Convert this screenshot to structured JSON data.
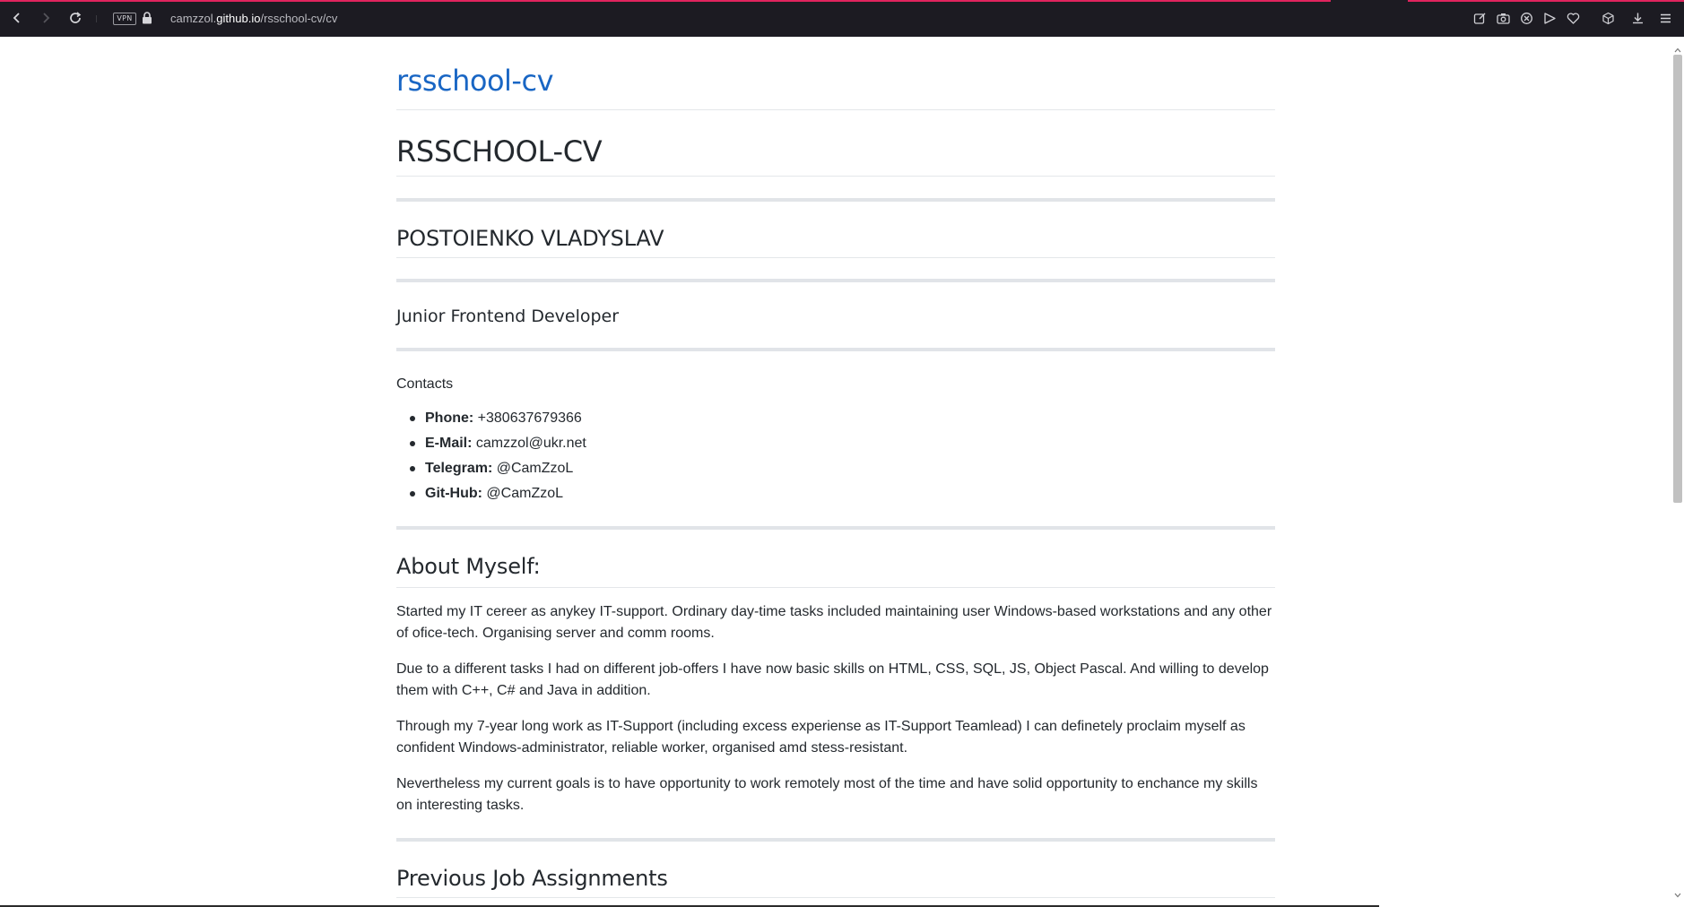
{
  "browser": {
    "url_host": "camzzol.github.io",
    "url_path": "/rsschool-cv/cv",
    "url_prefix": "camzzol.",
    "url_host_main": "github.io",
    "vpn_label": "VPN",
    "accent_color": "#e0245e"
  },
  "page": {
    "site_title": "rsschool-cv",
    "main_title": "RSSCHOOL-CV",
    "name": "POSTOIENKO VLADYSLAV",
    "position": "Junior Frontend Developer",
    "contacts": {
      "heading": "Contacts",
      "items": [
        {
          "label": "Phone:",
          "value": " +380637679366"
        },
        {
          "label": "E-Mail:",
          "value": " camzzol@ukr.net"
        },
        {
          "label": "Telegram:",
          "value": " @CamZzoL"
        },
        {
          "label": "Git-Hub:",
          "value": " @CamZzoL"
        }
      ]
    },
    "about": {
      "heading": "About Myself:",
      "paragraphs": [
        "Started my IT cereer as anykey IT-support. Ordinary day-time tasks included maintaining user Windows-based workstations and any other of ofice-tech. Organising server and comm rooms.",
        "Due to a different tasks I had on different job-offers I have now basic skills on HTML, CSS, SQL, JS, Object Pascal. And willing to develop them with C++, C# and Java in addition.",
        "Through my 7-year long work as IT-Support (including excess experiense as IT-Support Teamlead) I can definetely proclaim myself as confident Windows-administrator, reliable worker, organised amd stess-resistant.",
        "Nevertheless my current goals is to have opportunity to work remotely most of the time and have solid opportunity to enchance my skills on interesting tasks."
      ]
    },
    "jobs": {
      "heading": "Previous Job Assignments"
    },
    "link_color": "#1966c4"
  }
}
